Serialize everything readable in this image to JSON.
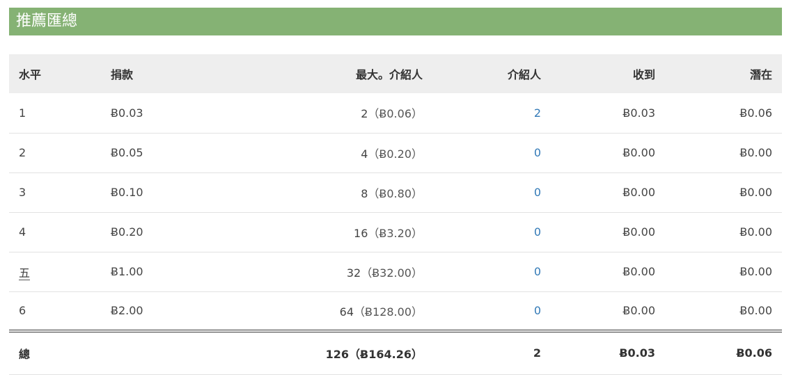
{
  "panel": {
    "title": "推薦匯總"
  },
  "table": {
    "headers": {
      "level": "水平",
      "donation": "捐款",
      "max_referrals": "最大。介紹人",
      "referrals": "介紹人",
      "received": "收到",
      "potential": "潛在"
    },
    "rows": [
      {
        "level": "1",
        "donation": "Ƀ0.03",
        "max_count": "2",
        "max_amount": "（Ƀ0.06）",
        "referrals": "2",
        "received": "Ƀ0.03",
        "potential": "Ƀ0.06"
      },
      {
        "level": "2",
        "donation": "Ƀ0.05",
        "max_count": "4",
        "max_amount": "（Ƀ0.20）",
        "referrals": "0",
        "received": "Ƀ0.00",
        "potential": "Ƀ0.00"
      },
      {
        "level": "3",
        "donation": "Ƀ0.10",
        "max_count": "8",
        "max_amount": "（Ƀ0.80）",
        "referrals": "0",
        "received": "Ƀ0.00",
        "potential": "Ƀ0.00"
      },
      {
        "level": "4",
        "donation": "Ƀ0.20",
        "max_count": "16",
        "max_amount": "（Ƀ3.20）",
        "referrals": "0",
        "received": "Ƀ0.00",
        "potential": "Ƀ0.00"
      },
      {
        "level": "五",
        "donation": "Ƀ1.00",
        "max_count": "32",
        "max_amount": "（Ƀ32.00）",
        "referrals": "0",
        "received": "Ƀ0.00",
        "potential": "Ƀ0.00"
      },
      {
        "level": "6",
        "donation": "Ƀ2.00",
        "max_count": "64",
        "max_amount": "（Ƀ128.00）",
        "referrals": "0",
        "received": "Ƀ0.00",
        "potential": "Ƀ0.00"
      }
    ],
    "total": {
      "label": "總",
      "max_count": "126",
      "max_amount": "（Ƀ164.26）",
      "referrals": "2",
      "received": "Ƀ0.03",
      "potential": "Ƀ0.06"
    }
  },
  "colors": {
    "header_bar": "#85b274",
    "link": "#337ab7",
    "table_head_bg": "#eeeeee"
  }
}
